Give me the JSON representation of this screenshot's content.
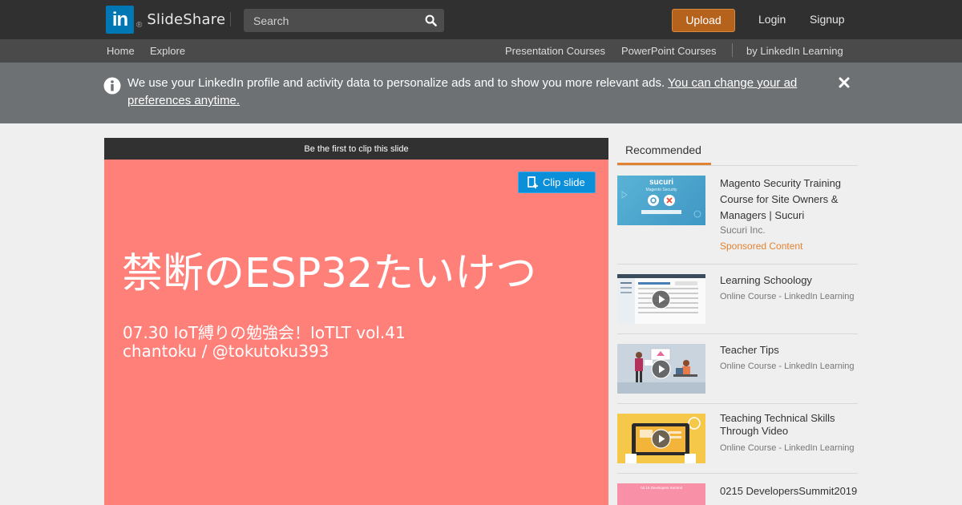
{
  "header": {
    "logo_text": "SlideShare",
    "search_placeholder": "Search",
    "upload_label": "Upload",
    "login_label": "Login",
    "signup_label": "Signup"
  },
  "subnav": {
    "home": "Home",
    "explore": "Explore",
    "presentation_courses": "Presentation Courses",
    "powerpoint_courses": "PowerPoint Courses",
    "linkedin_learning": "by LinkedIn Learning"
  },
  "notice": {
    "text": "We use your LinkedIn profile and activity data to personalize ads and to show you more relevant ads. ",
    "link": "You can change your ad preferences anytime."
  },
  "slide": {
    "header": "Be the first to clip this slide",
    "clip_label": "Clip slide",
    "title": "禁断のESP32たいけつ",
    "subtitle_line1": "07.30 IoT縛りの勉強会！IoTLT vol.41",
    "subtitle_line2": "chantoku / @tokutoku393"
  },
  "sidebar": {
    "tab_label": "Recommended",
    "items": [
      {
        "title": "Magento Security Training Course for Site Owners & Managers | Sucuri",
        "source": "Sucuri Inc.",
        "sponsored": "Sponsored Content",
        "thumb_text": "sucuri",
        "thumb_subtext": "Magento Security"
      },
      {
        "title": "Learning Schoology",
        "source": "Online Course - LinkedIn Learning"
      },
      {
        "title": "Teacher Tips",
        "source": "Online Course - LinkedIn Learning"
      },
      {
        "title": "Teaching Technical Skills Through Video",
        "source": "Online Course - LinkedIn Learning"
      },
      {
        "title": "0215 DevelopersSummit2019",
        "thumb_text": "02.15 Developers Summit"
      }
    ]
  },
  "colors": {
    "slide_bg": "#ff7f79",
    "upload_bg": "#b5631c",
    "clip_bg": "#0a8fd8",
    "accent": "#e28333",
    "linkedin_blue": "#0077b5"
  }
}
